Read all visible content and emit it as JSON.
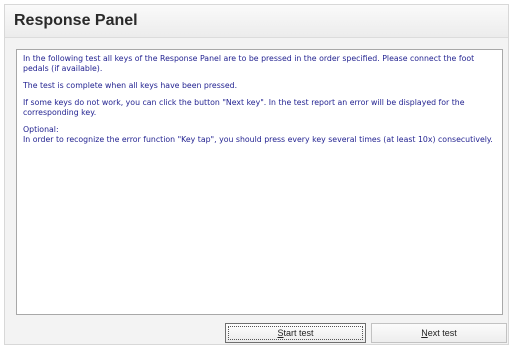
{
  "window": {
    "title": "Response Panel"
  },
  "content": {
    "paragraph1": "In the following test all keys of the Response Panel are to be pressed in the order specified. Please connect the foot pedals (if available).",
    "paragraph2": "The test is complete when all keys have been pressed.",
    "paragraph3": "If some keys do not work, you can click the button \"Next key\". In the test report an error will be displayed for the corresponding key.",
    "optional_label": "Optional:",
    "paragraph4": "In order to recognize the error function \"Key tap\", you should press every key several times (at least 10x) consecutively."
  },
  "buttons": {
    "start_mnemonic": "S",
    "start_rest": "tart test",
    "next_mnemonic": "N",
    "next_rest": "ext test"
  }
}
